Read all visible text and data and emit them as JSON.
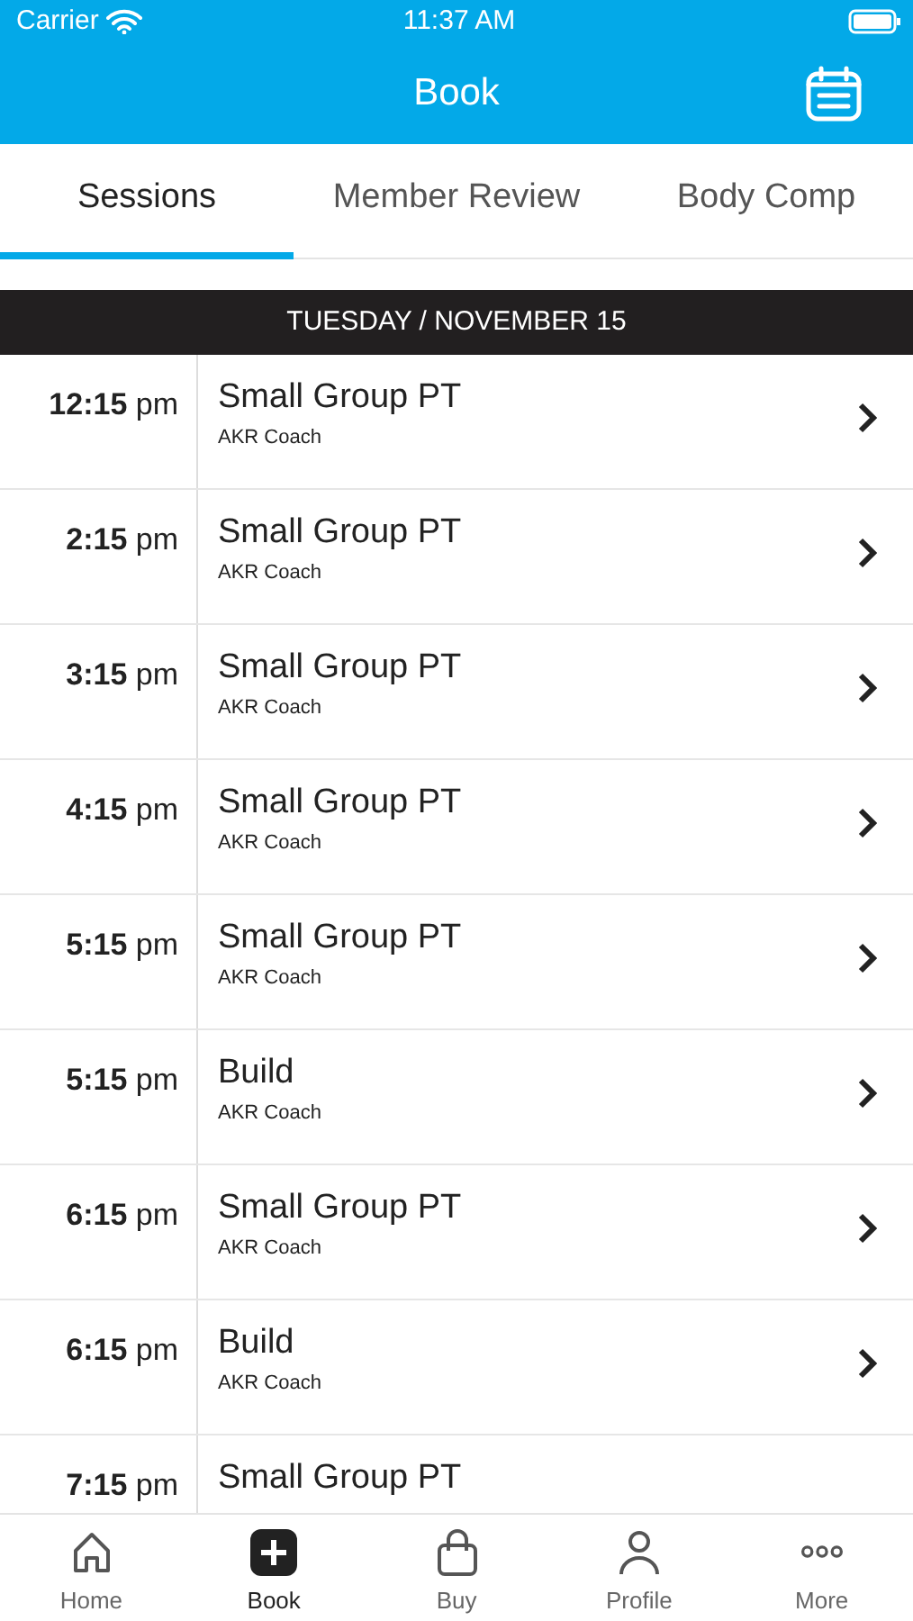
{
  "status_bar": {
    "carrier": "Carrier",
    "time": "11:37 AM"
  },
  "header": {
    "title": "Book"
  },
  "tabs": [
    {
      "label": "Sessions",
      "selected": true
    },
    {
      "label": "Member Review",
      "selected": false
    },
    {
      "label": "Body Comp",
      "selected": false
    }
  ],
  "date_header": "TUESDAY / NOVEMBER 15",
  "sessions": [
    {
      "time": "**12:15** pm",
      "name": "Small Group PT",
      "coach": "AKR Coach"
    },
    {
      "time": "**2:15** pm",
      "name": "Small Group PT",
      "coach": "AKR Coach"
    },
    {
      "time": "**3:15** pm",
      "name": "Small Group PT",
      "coach": "AKR Coach"
    },
    {
      "time": "**4:15** pm",
      "name": "Small Group PT",
      "coach": "AKR Coach"
    },
    {
      "time": "**5:15** pm",
      "name": "Small Group PT",
      "coach": "AKR Coach"
    },
    {
      "time": "**5:15** pm",
      "name": "Build",
      "coach": "AKR Coach"
    },
    {
      "time": "**6:15** pm",
      "name": "Small Group PT",
      "coach": "AKR Coach"
    },
    {
      "time": "**6:15** pm",
      "name": "Build",
      "coach": "AKR Coach"
    },
    {
      "time": "**7:15** pm",
      "name": "Small Group PT"
    }
  ],
  "tab_bar": [
    {
      "kind": "home",
      "label": "Home",
      "selected": false
    },
    {
      "kind": "book",
      "label": "Book",
      "selected": true
    },
    {
      "kind": "buy",
      "label": "Buy",
      "selected": false
    },
    {
      "kind": "profile",
      "label": "Profile",
      "selected": false
    },
    {
      "kind": "more",
      "label": "More",
      "selected": false
    }
  ]
}
